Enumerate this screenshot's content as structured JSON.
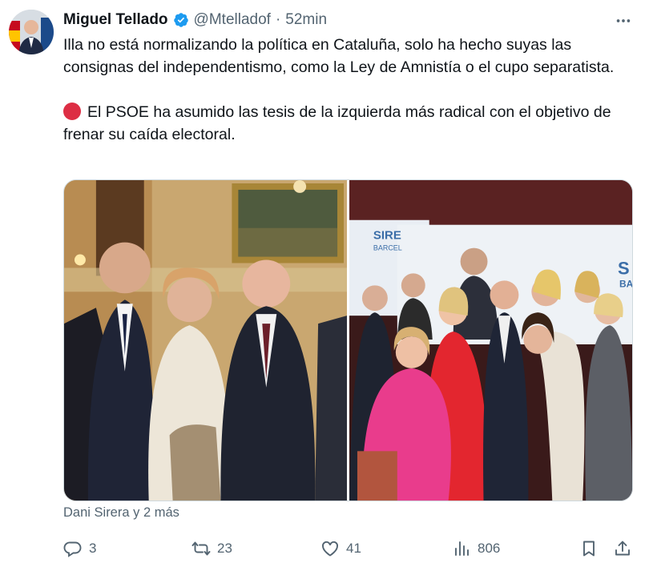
{
  "author": {
    "name": "Miguel Tellado",
    "handle": "@Mtelladof",
    "separator": "·",
    "time": "52min"
  },
  "tweet": {
    "paragraph1": "Illa no está normalizando la política en Cataluña, solo ha hecho suyas las consignas del independentismo, como la Ley de Amnistía o el cupo separatista.",
    "paragraph2": "El PSOE ha asumido las tesis de la izquierda más radical con el objetivo de frenar su caída electoral."
  },
  "media": {
    "photo_left_sign": "",
    "photo_right_sign": "SIRERA BARCELONA",
    "photo_right_sign_left": "SIRE",
    "photo_right_sign_left_sub": "BARCEL",
    "photo_right_sign_right": "S",
    "photo_right_sign_right_sub": "BA"
  },
  "tagged": "Dani Sirera y 2 más",
  "actions": {
    "replies": "3",
    "reposts": "23",
    "likes": "41",
    "views": "806"
  },
  "colors": {
    "text": "#0f1419",
    "secondary": "#536471",
    "verified": "#1d9bf0",
    "border": "#cfd9de"
  }
}
